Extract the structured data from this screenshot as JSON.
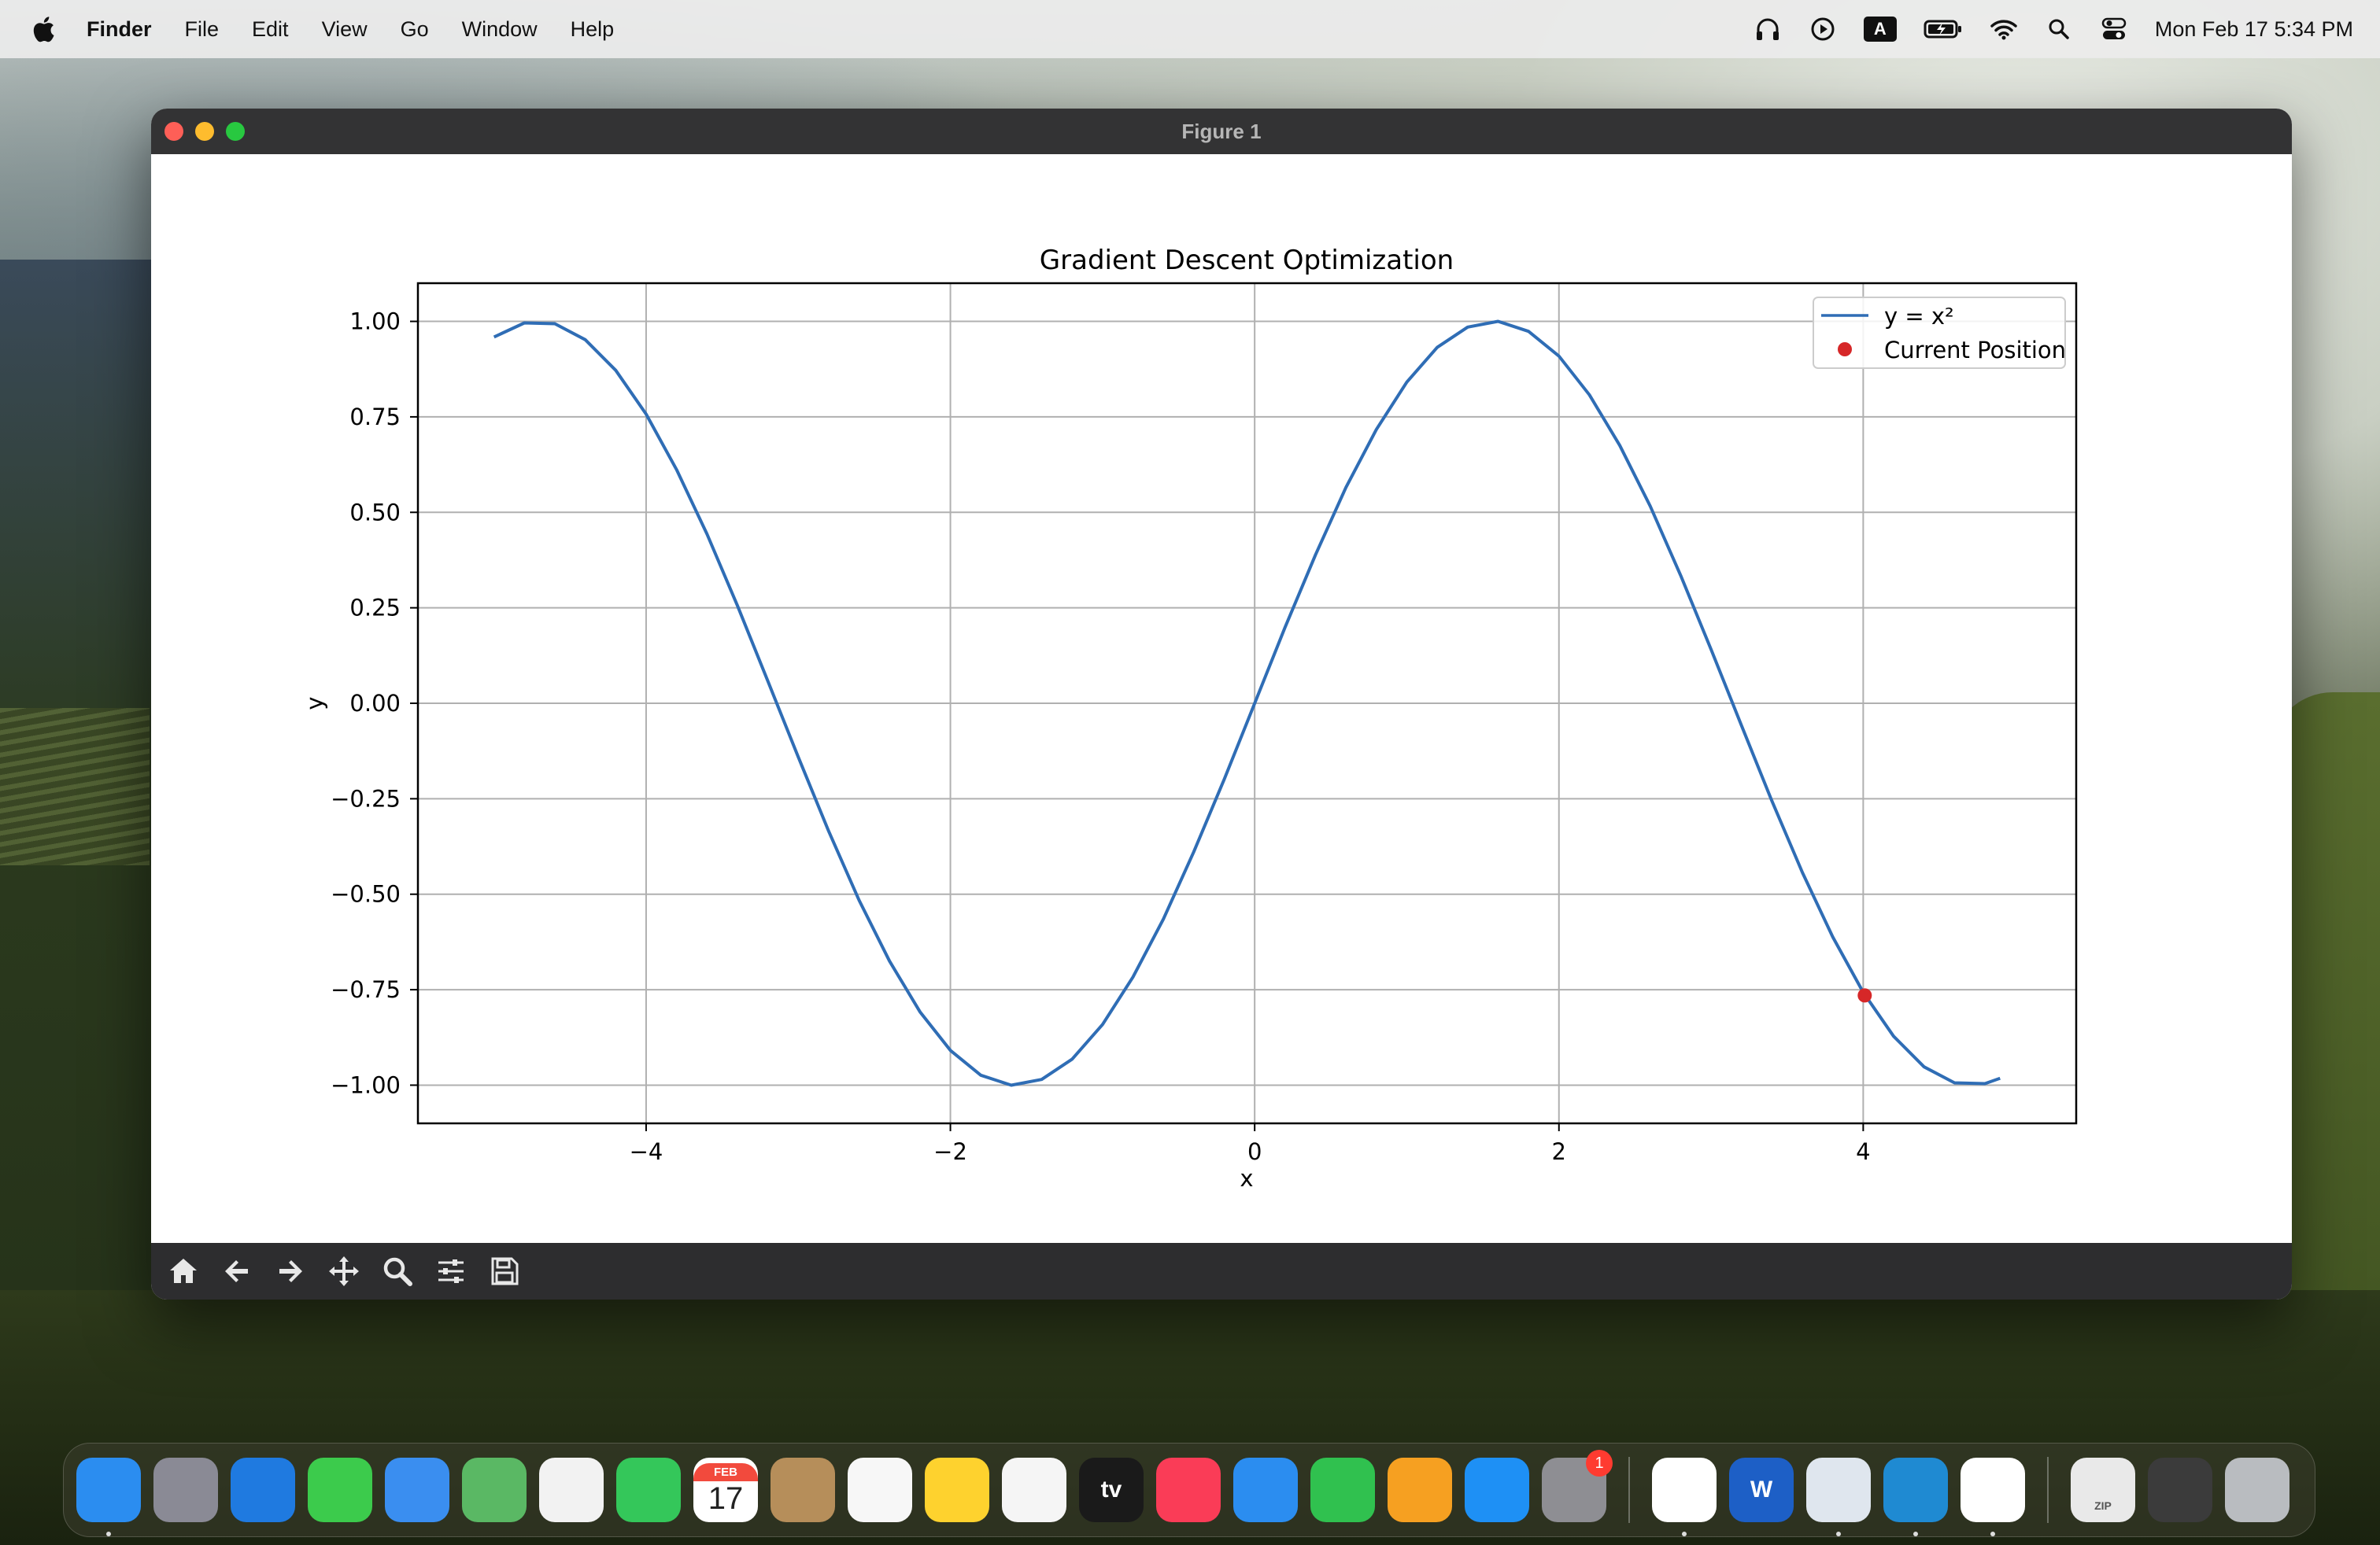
{
  "menubar": {
    "app_name": "Finder",
    "items": [
      "File",
      "Edit",
      "View",
      "Go",
      "Window",
      "Help"
    ],
    "status": {
      "input_source": "A",
      "clock": "Mon Feb 17  5:34 PM"
    }
  },
  "window": {
    "title": "Figure 1",
    "toolbar_tools": [
      "home-icon",
      "back-arrow-icon",
      "forward-arrow-icon",
      "pan-icon",
      "zoom-icon",
      "configure-subplots-icon",
      "save-icon"
    ]
  },
  "chart_data": {
    "type": "line",
    "title": "Gradient Descent Optimization",
    "xlabel": "x",
    "ylabel": "y",
    "xlim": [
      -5.5,
      5.4
    ],
    "ylim": [
      -1.1,
      1.1
    ],
    "xticks": [
      -4,
      -2,
      0,
      2,
      4
    ],
    "xtick_labels": [
      "−4",
      "−2",
      "0",
      "2",
      "4"
    ],
    "yticks": [
      1.0,
      0.75,
      0.5,
      0.25,
      0.0,
      -0.25,
      -0.5,
      -0.75,
      -1.0
    ],
    "ytick_labels": [
      "1.00",
      "0.75",
      "0.50",
      "0.25",
      "0.00",
      "−0.25",
      "−0.50",
      "−0.75",
      "−1.00"
    ],
    "grid": true,
    "legend_position": "top-right",
    "series": [
      {
        "name": "y = x²",
        "color": "#2f6db5",
        "x": [
          -5.0,
          -4.8,
          -4.6,
          -4.4,
          -4.2,
          -4.0,
          -3.8,
          -3.6,
          -3.4,
          -3.2,
          -3.0,
          -2.8,
          -2.6,
          -2.4,
          -2.2,
          -2.0,
          -1.8,
          -1.6,
          -1.4,
          -1.2,
          -1.0,
          -0.8,
          -0.6,
          -0.4,
          -0.2,
          0.0,
          0.2,
          0.4,
          0.6,
          0.8,
          1.0,
          1.2,
          1.4,
          1.6,
          1.8,
          2.0,
          2.2,
          2.4,
          2.6,
          2.8,
          3.0,
          3.2,
          3.4,
          3.6,
          3.8,
          4.0,
          4.2,
          4.4,
          4.6,
          4.8,
          4.9
        ],
        "y": [
          0.959,
          0.996,
          0.994,
          0.952,
          0.872,
          0.757,
          0.612,
          0.443,
          0.256,
          0.058,
          -0.141,
          -0.335,
          -0.516,
          -0.675,
          -0.808,
          -0.909,
          -0.974,
          -1.0,
          -0.985,
          -0.932,
          -0.841,
          -0.717,
          -0.565,
          -0.389,
          -0.199,
          0.0,
          0.199,
          0.389,
          0.565,
          0.717,
          0.841,
          0.932,
          0.985,
          1.0,
          0.974,
          0.909,
          0.808,
          0.675,
          0.516,
          0.335,
          0.141,
          -0.058,
          -0.256,
          -0.443,
          -0.612,
          -0.757,
          -0.872,
          -0.952,
          -0.994,
          -0.996,
          -0.982
        ]
      },
      {
        "name": "Current Position",
        "type": "scatter",
        "color": "#d62728",
        "x": [
          4.01
        ],
        "y": [
          -0.765
        ]
      }
    ]
  },
  "dock": {
    "apps": [
      {
        "name": "finder-icon",
        "color": "#2b8df0",
        "running": true
      },
      {
        "name": "launchpad-icon",
        "color": "#8a8a95"
      },
      {
        "name": "safari-icon",
        "color": "#1f7ae0"
      },
      {
        "name": "messages-icon",
        "color": "#3ccb4c"
      },
      {
        "name": "mail-icon",
        "color": "#3a8ef0"
      },
      {
        "name": "maps-icon",
        "color": "#5ab864"
      },
      {
        "name": "photos-icon",
        "color": "#f2f2f2"
      },
      {
        "name": "facetime-icon",
        "color": "#34c75a"
      },
      {
        "name": "calendar-icon",
        "color": "#ffffff",
        "month": "FEB",
        "day": "17"
      },
      {
        "name": "contacts-icon",
        "color": "#b68e5a"
      },
      {
        "name": "reminders-icon",
        "color": "#f7f7f7"
      },
      {
        "name": "notes-icon",
        "color": "#fed22e"
      },
      {
        "name": "freeform-icon",
        "color": "#f5f5f5"
      },
      {
        "name": "tv-icon",
        "color": "#1a1a1a",
        "label": "tv"
      },
      {
        "name": "music-icon",
        "color": "#fa3c57"
      },
      {
        "name": "keynote-icon",
        "color": "#2b8df0"
      },
      {
        "name": "numbers-icon",
        "color": "#30c14f"
      },
      {
        "name": "pages-icon",
        "color": "#f6a021"
      },
      {
        "name": "app-store-icon",
        "color": "#1e90f5"
      },
      {
        "name": "system-settings-icon",
        "color": "#8e8e93",
        "badge": "1"
      }
    ],
    "apps2": [
      {
        "name": "chrome-icon",
        "color": "#ffffff",
        "running": true
      },
      {
        "name": "word-icon",
        "color": "#1d5fc6",
        "label": "W"
      },
      {
        "name": "preview-icon",
        "color": "#dfe6ee",
        "running": true
      },
      {
        "name": "vscode-icon",
        "color": "#1f8ad2",
        "running": true
      },
      {
        "name": "pinwheel-icon",
        "color": "#ffffff",
        "running": true
      }
    ],
    "apps3": [
      {
        "name": "archive-icon",
        "color": "#e9e9e9",
        "label": "ZIP"
      },
      {
        "name": "screenshot-folder-icon",
        "color": "#3b3b3b"
      },
      {
        "name": "trash-icon",
        "color": "#b9bcc0"
      }
    ]
  }
}
